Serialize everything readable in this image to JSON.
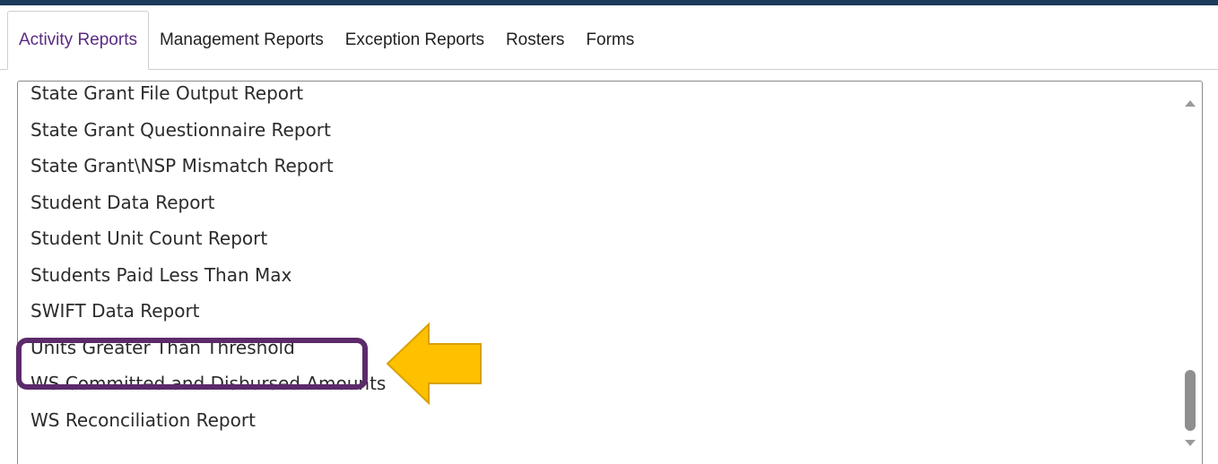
{
  "tabs": [
    {
      "label": "Activity Reports",
      "active": true
    },
    {
      "label": "Management Reports",
      "active": false
    },
    {
      "label": "Exception Reports",
      "active": false
    },
    {
      "label": "Rosters",
      "active": false
    },
    {
      "label": "Forms",
      "active": false
    }
  ],
  "report_list": {
    "items": [
      "State Grant File Output Report",
      "State Grant Questionnaire Report",
      "State Grant\\NSP Mismatch Report",
      "Student Data Report",
      "Student Unit Count Report",
      "Students Paid Less Than Max",
      "SWIFT Data Report",
      "Units Greater Than Threshold",
      "WS Committed and Disbursed Amounts",
      "WS Reconciliation Report"
    ],
    "highlighted_item": "Units Greater Than Threshold"
  },
  "colors": {
    "top_bar": "#1b3a5c",
    "active_tab_text": "#5b2b82",
    "highlight_border": "#5c2a6b",
    "arrow_fill": "#ffc000",
    "arrow_stroke": "#d9a200"
  },
  "icons": {
    "scroll_up": "chevron-up-icon",
    "scroll_down": "chevron-down-icon",
    "callout_arrow": "arrow-left-icon"
  }
}
